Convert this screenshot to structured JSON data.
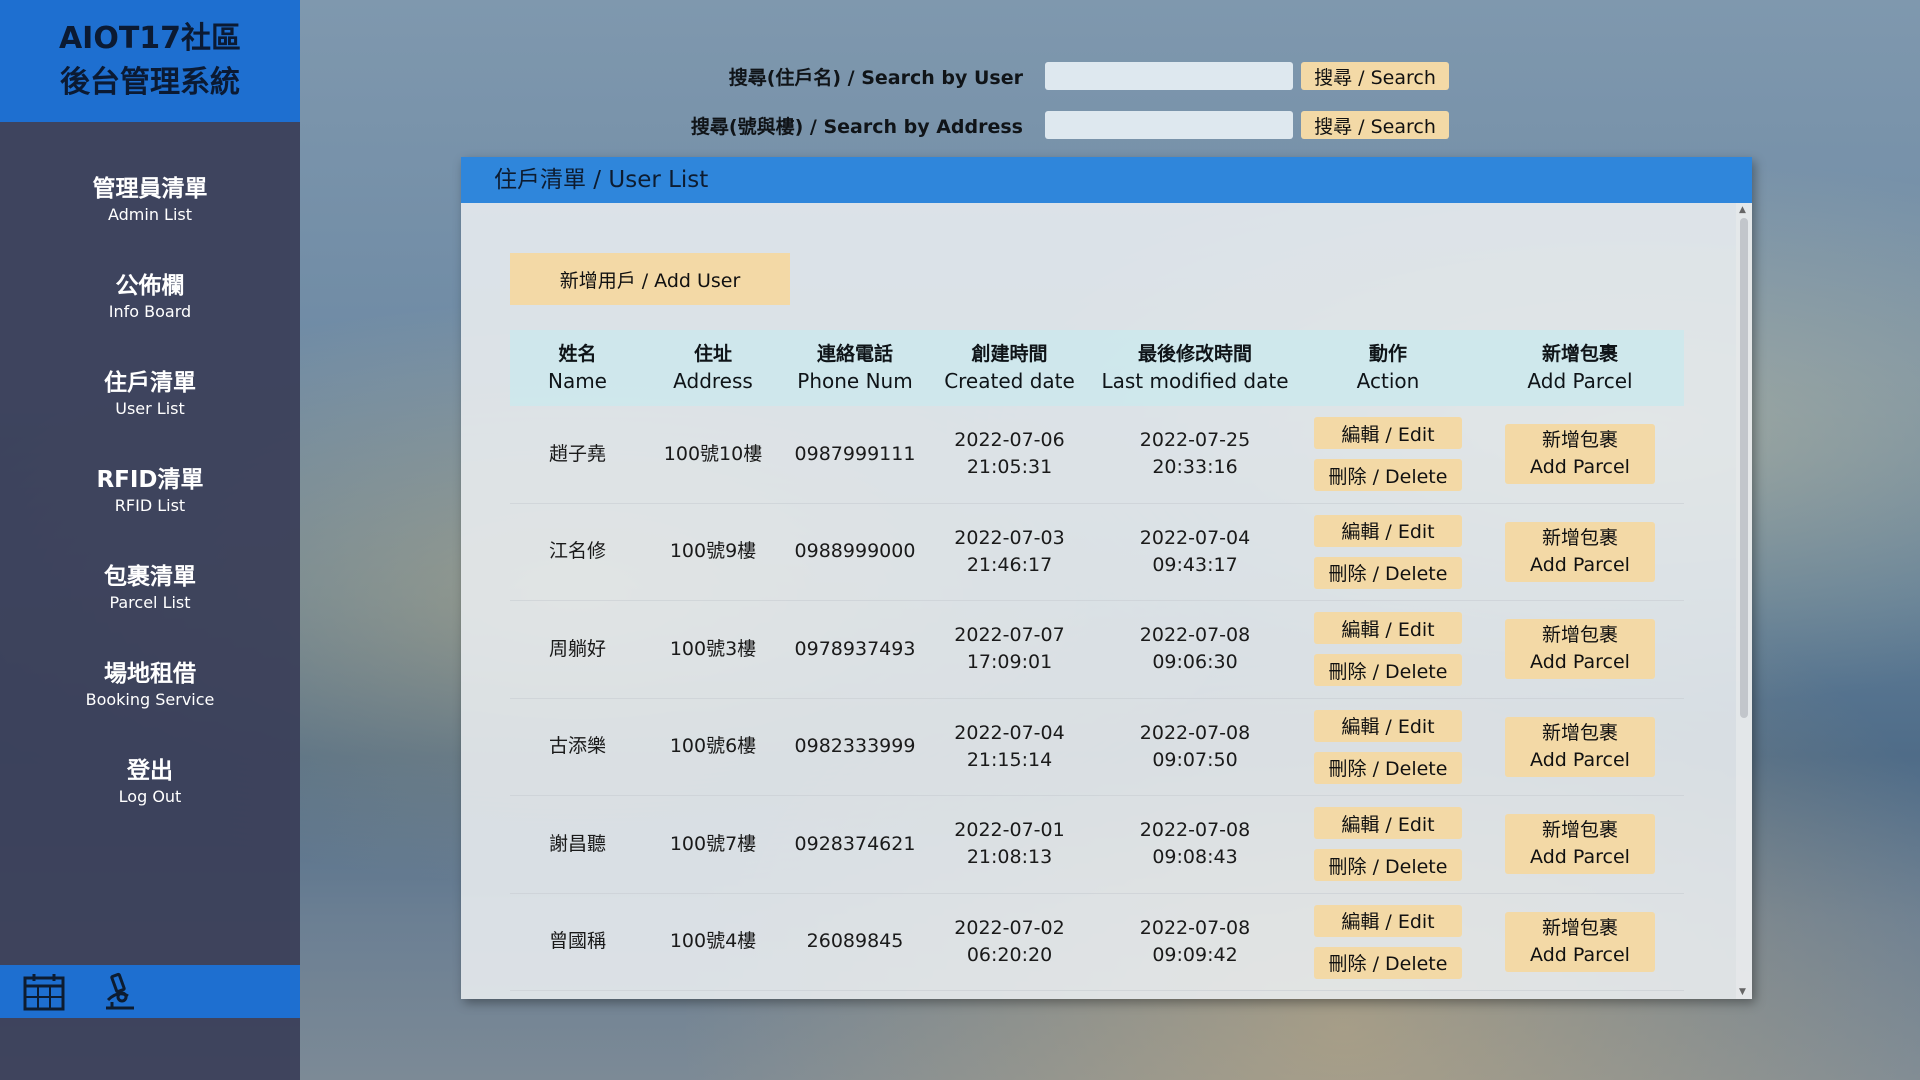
{
  "brand": {
    "line1": "AIOT17社區",
    "line2": "後台管理系統"
  },
  "sidebar": {
    "items": [
      {
        "zh": "管理員清單",
        "en": "Admin List"
      },
      {
        "zh": "公佈欄",
        "en": "Info Board"
      },
      {
        "zh": "住戶清單",
        "en": "User List"
      },
      {
        "zh": "RFID清單",
        "en": "RFID List"
      },
      {
        "zh": "包裹清單",
        "en": "Parcel List"
      },
      {
        "zh": "場地租借",
        "en": "Booking Service"
      },
      {
        "zh": "登出",
        "en": "Log Out"
      }
    ],
    "footer_icons": [
      "calendar-icon",
      "microscope-icon"
    ]
  },
  "search": {
    "user": {
      "label": "搜尋(住戶名) / Search by User",
      "value": "",
      "button": "搜尋 / Search"
    },
    "address": {
      "label": "搜尋(號與樓) / Search by Address",
      "value": "",
      "button": "搜尋 / Search"
    }
  },
  "panel": {
    "title": "住戶清單 / User List",
    "add_user": "新增用戶 / Add User",
    "headers": [
      {
        "zh": "姓名",
        "en": "Name"
      },
      {
        "zh": "住址",
        "en": "Address"
      },
      {
        "zh": "連絡電話",
        "en": "Phone Num"
      },
      {
        "zh": "創建時間",
        "en": "Created date"
      },
      {
        "zh": "最後修改時間",
        "en": "Last modified date"
      },
      {
        "zh": "動作",
        "en": "Action"
      },
      {
        "zh": "新增包裹",
        "en": "Add Parcel"
      }
    ],
    "edit_label": "編輯 / Edit",
    "delete_label": "刪除 / Delete",
    "parcel_zh": "新增包裹",
    "parcel_en": "Add Parcel",
    "rows": [
      {
        "name": "趙子堯",
        "address": "100號10樓",
        "phone": "0987999111",
        "created_date": "2022-07-06",
        "created_time": "21:05:31",
        "modified_date": "2022-07-25",
        "modified_time": "20:33:16"
      },
      {
        "name": "江名修",
        "address": "100號9樓",
        "phone": "0988999000",
        "created_date": "2022-07-03",
        "created_time": "21:46:17",
        "modified_date": "2022-07-04",
        "modified_time": "09:43:17"
      },
      {
        "name": "周躺好",
        "address": "100號3樓",
        "phone": "0978937493",
        "created_date": "2022-07-07",
        "created_time": "17:09:01",
        "modified_date": "2022-07-08",
        "modified_time": "09:06:30"
      },
      {
        "name": "古添樂",
        "address": "100號6樓",
        "phone": "0982333999",
        "created_date": "2022-07-04",
        "created_time": "21:15:14",
        "modified_date": "2022-07-08",
        "modified_time": "09:07:50"
      },
      {
        "name": "謝昌聽",
        "address": "100號7樓",
        "phone": "0928374621",
        "created_date": "2022-07-01",
        "created_time": "21:08:13",
        "modified_date": "2022-07-08",
        "modified_time": "09:08:43"
      },
      {
        "name": "曾國稱",
        "address": "100號4樓",
        "phone": "26089845",
        "created_date": "2022-07-02",
        "created_time": "06:20:20",
        "modified_date": "2022-07-08",
        "modified_time": "09:09:42"
      }
    ]
  }
}
